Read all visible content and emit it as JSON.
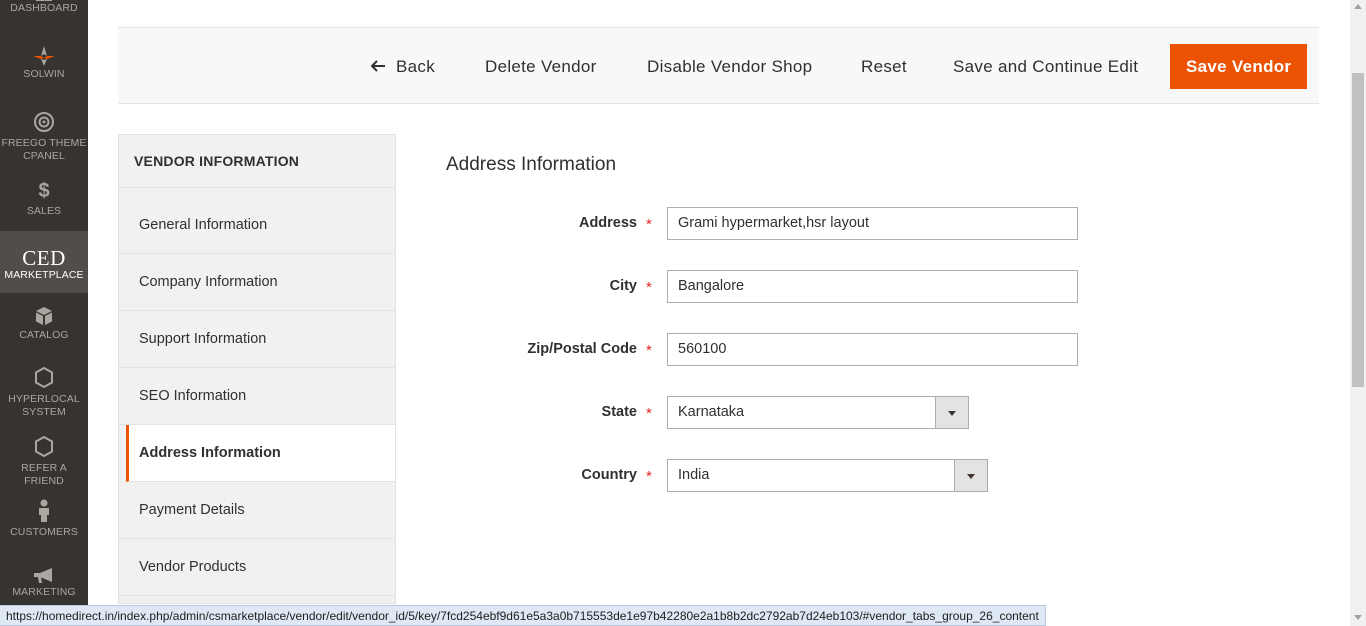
{
  "admin_menu": {
    "items": [
      {
        "label": "DASHBOARD",
        "icon": "dashboard-icon"
      },
      {
        "label": "SOLWIN",
        "icon": "solwin-logo-icon"
      },
      {
        "label": "FREEGO THEME CPANEL",
        "line1": "FREEGO THEME",
        "line2": "CPANEL",
        "icon": "target-icon"
      },
      {
        "label": "SALES",
        "icon": "dollar-icon"
      },
      {
        "label": "MARKETPLACE",
        "logo_text": "CED",
        "icon": "ced-logo-icon",
        "active": true
      },
      {
        "label": "CATALOG",
        "icon": "cube-icon"
      },
      {
        "label": "HYPERLOCAL SYSTEM",
        "line1": "HYPERLOCAL",
        "line2": "SYSTEM",
        "icon": "hexagon-icon"
      },
      {
        "label": "REFER A FRIEND",
        "line1": "REFER A",
        "line2": "FRIEND",
        "icon": "hexagon-icon"
      },
      {
        "label": "CUSTOMERS",
        "icon": "person-icon"
      },
      {
        "label": "MARKETING",
        "icon": "megaphone-icon"
      }
    ]
  },
  "actions": {
    "back": "Back",
    "delete": "Delete Vendor",
    "disable": "Disable Vendor Shop",
    "reset": "Reset",
    "save_continue": "Save and Continue Edit",
    "save": "Save Vendor"
  },
  "tabs": {
    "title": "VENDOR INFORMATION",
    "items": [
      {
        "label": "General Information"
      },
      {
        "label": "Company Information"
      },
      {
        "label": "Support Information"
      },
      {
        "label": "SEO Information"
      },
      {
        "label": "Address Information",
        "active": true
      },
      {
        "label": "Payment Details"
      },
      {
        "label": "Vendor Products"
      }
    ]
  },
  "form": {
    "title": "Address Information",
    "required_mark": "*",
    "fields": {
      "address": {
        "label": "Address",
        "value": "Grami hypermarket,hsr layout"
      },
      "city": {
        "label": "City",
        "value": "Bangalore"
      },
      "zip": {
        "label": "Zip/Postal Code",
        "value": "560100"
      },
      "state": {
        "label": "State",
        "value": "Karnataka"
      },
      "country": {
        "label": "Country",
        "value": "India"
      }
    }
  },
  "status_url": "https://homedirect.in/index.php/admin/csmarketplace/vendor/edit/vendor_id/5/key/7fcd254ebf9d61e5a3a0b715553de1e97b42280e2a1b8b2dc2792ab7d24eb103/#vendor_tabs_group_26_content",
  "colors": {
    "accent": "#eb5202",
    "menu_bg": "#373330",
    "required": "#e22626"
  }
}
